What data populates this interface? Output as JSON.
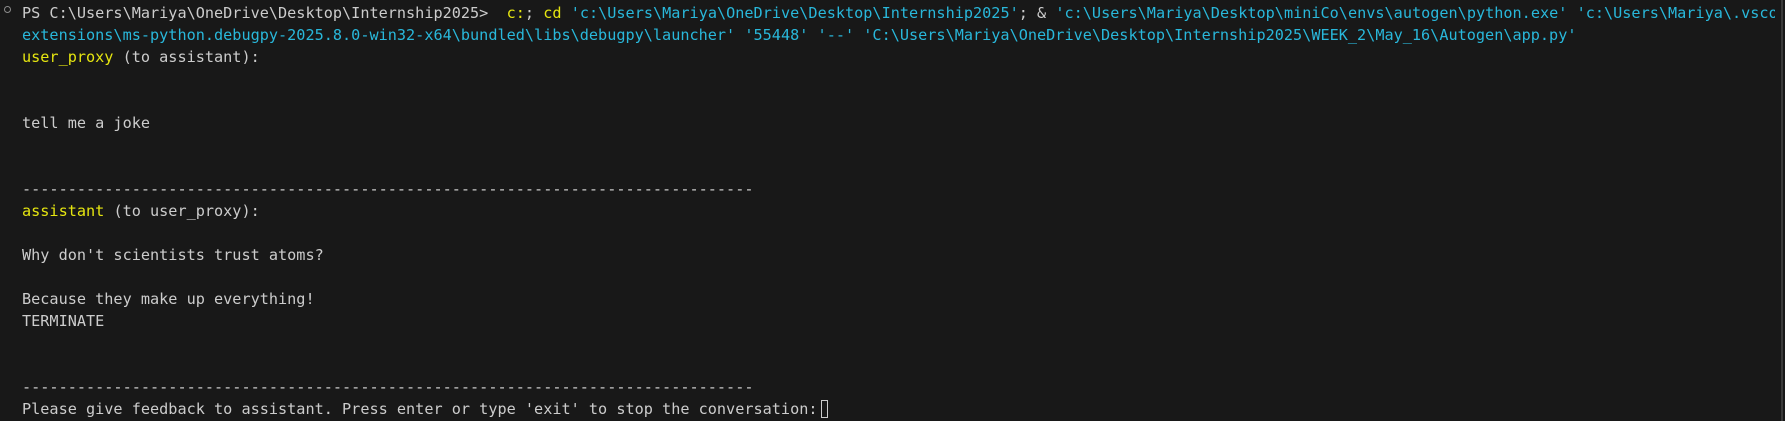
{
  "prompt": {
    "ps_prefix": "PS C:\\Users\\Mariya\\OneDrive\\Desktop\\Internship2025>",
    "cmd_c": "c:",
    "cmd_semicolon": ";",
    "cmd_cd": "cd",
    "cd_path": "'c:\\Users\\Mariya\\OneDrive\\Desktop\\Internship2025'",
    "after_cd": ";",
    "amp": "&",
    "python_path": "'c:\\Users\\Mariya\\Desktop\\miniCo\\envs\\autogen\\python.exe'",
    "vscode_path_start": "'c:\\Users\\Mariya\\.vscode\\",
    "vscode_path_end": "extensions\\ms-python.debugpy-2025.8.0-win32-x64\\bundled\\libs\\debugpy\\launcher'",
    "port": "'55448'",
    "dashdash": "'--'",
    "script_path": "'C:\\Users\\Mariya\\OneDrive\\Desktop\\Internship2025\\WEEK_2\\May_16\\Autogen\\app.py'"
  },
  "messages": {
    "user_header_role": "user_proxy",
    "user_header_rest": " (to assistant):",
    "user_text": "tell me a joke",
    "separator": "--------------------------------------------------------------------------------",
    "assistant_header_role": "assistant",
    "assistant_header_rest": " (to user_proxy):",
    "assistant_line1": "Why don't scientists trust atoms?",
    "assistant_line2": "Because they make up everything!",
    "assistant_line3": "TERMINATE",
    "feedback_prompt": "Please give feedback to assistant. Press enter or type 'exit' to stop the conversation:"
  },
  "colors": {
    "background": "#181818",
    "text": "#cccccc",
    "yellow": "#e5e510",
    "cyan": "#29b8db"
  }
}
